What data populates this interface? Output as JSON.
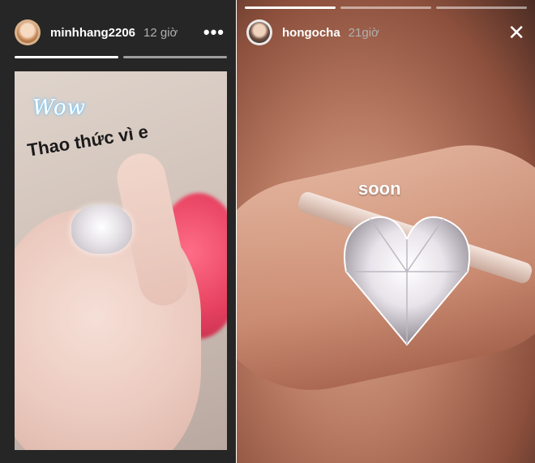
{
  "left_story": {
    "username": "minhhang2206",
    "time": "12 giờ",
    "more_label": "•••",
    "sticker": "Wow",
    "caption": "Thao thức vì e"
  },
  "right_story": {
    "username": "hongocha",
    "time": "21giờ",
    "close_label": "✕",
    "caption": "soon"
  },
  "colors": {
    "background_dark": "#262626",
    "progress_active": "#ffffff",
    "progress_inactive": "#9e9e9e"
  }
}
